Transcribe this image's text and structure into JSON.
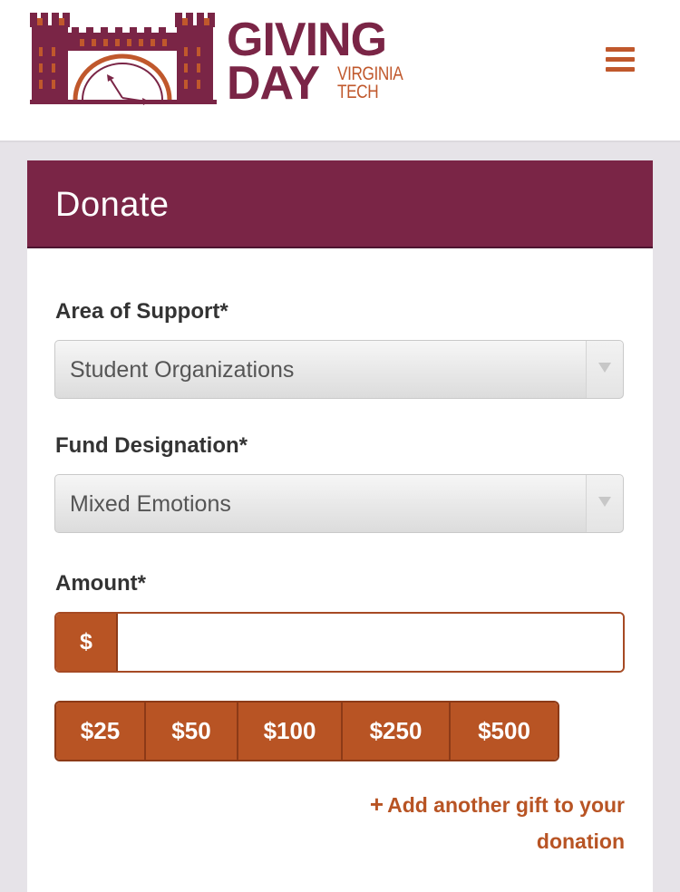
{
  "header": {
    "logo_line1": "GIVING",
    "logo_line2": "DAY",
    "logo_sub1": "VIRGINIA",
    "logo_sub2": "TECH",
    "menu_icon": "hamburger-menu-icon"
  },
  "card": {
    "title": "Donate"
  },
  "form": {
    "area_label": "Area of Support*",
    "area_value": "Student Organizations",
    "fund_label": "Fund Designation*",
    "fund_value": "Mixed Emotions",
    "amount_label": "Amount*",
    "currency_symbol": "$",
    "amount_value": "",
    "presets": [
      "$25",
      "$50",
      "$100",
      "$250",
      "$500"
    ],
    "add_gift_icon": "+",
    "add_gift_text": "Add another gift to your donation"
  },
  "colors": {
    "maroon": "#7a2546",
    "orange": "#b85424",
    "background": "#e6e3e8"
  }
}
